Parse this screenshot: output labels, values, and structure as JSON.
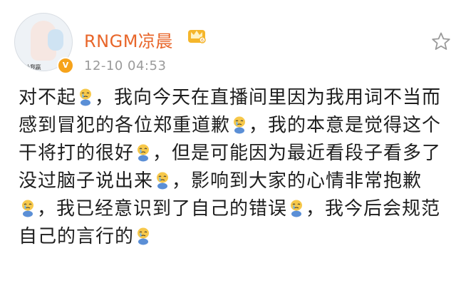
{
  "post": {
    "avatar_caption": "不让我赢",
    "verified_badge": "V",
    "username": "RNGM凉晨",
    "timestamp": "12-10 04:53",
    "icons": {
      "crown": "crown-icon",
      "star": "star-icon",
      "emoji": "crying-emoji-icon"
    },
    "lines": [
      [
        "对不起",
        "，我向今天在直播间里因为我用词不当而"
      ],
      [
        "感到冒犯的各位郑重道歉",
        "，我的本意是觉得这个"
      ],
      [
        "干将打的很好",
        "，但是可能因为最近看段子看多了"
      ],
      [
        "没过脑子说出来",
        "，影响到大家的心情非常抱歉"
      ],
      [
        "",
        "，我已经意识到了自己的错误",
        "，我今后会规范"
      ],
      [
        "自己的言行的",
        ""
      ]
    ]
  },
  "colors": {
    "username": "#e8662a",
    "timestamp": "#9a9a9a",
    "text": "#1e1e1e",
    "badge": "#f6a31b"
  }
}
